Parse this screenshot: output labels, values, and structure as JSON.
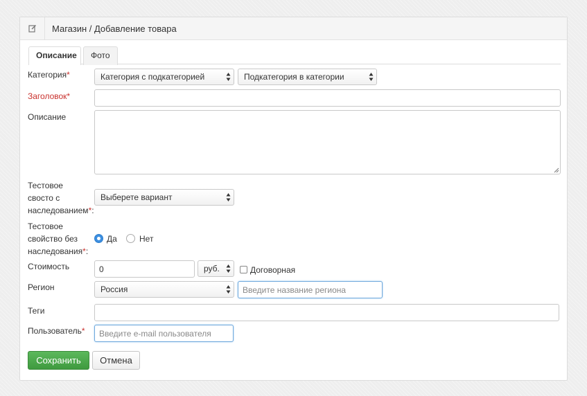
{
  "header": {
    "title": "Магазин / Добавление товара",
    "icon": "edit-icon"
  },
  "tabs": [
    {
      "label": "Описание",
      "active": true
    },
    {
      "label": "Фото",
      "active": false
    }
  ],
  "form": {
    "category": {
      "label": "Категория",
      "required_mark": "*",
      "select1": "Категория с подкатегорией",
      "select2": "Подкатегория в категории"
    },
    "title": {
      "label": "Заголовок",
      "required_mark": "*",
      "value": ""
    },
    "description": {
      "label": "Описание",
      "value": ""
    },
    "test_inherited": {
      "label_line1": "Тестовое",
      "label_line2": "свосто с",
      "label_line3": "наследованием",
      "required_mark": "*",
      "colon": ":",
      "select": "Выберете вариант"
    },
    "test_no_inherit": {
      "label_line1": "Тестовое",
      "label_line2": "свойство без",
      "label_line3": "наследования",
      "required_mark": "*",
      "colon": ":",
      "options": [
        "Да",
        "Нет"
      ],
      "selected": "Да"
    },
    "price": {
      "label": "Стоимость",
      "value": "0",
      "currency": "руб.",
      "negotiable_label": "Договорная",
      "negotiable_checked": false
    },
    "region": {
      "label": "Регион",
      "select": "Россия",
      "placeholder": "Введите название региона"
    },
    "tags": {
      "label": "Теги",
      "value": ""
    },
    "user": {
      "label": "Пользователь",
      "required_mark": "*",
      "placeholder": "Введите e-mail пользователя"
    }
  },
  "buttons": {
    "save": "Сохранить",
    "cancel": "Отмена"
  },
  "colors": {
    "required": "#c9302c",
    "save_button": "#4cae4c",
    "radio_active": "#3d8fe0",
    "focus_border": "#6fa8dc"
  }
}
